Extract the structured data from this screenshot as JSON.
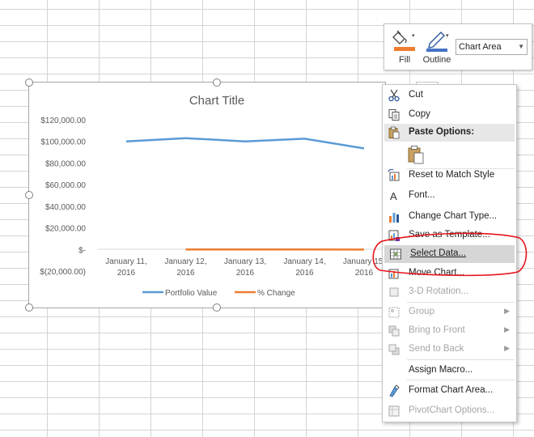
{
  "format_toolbar": {
    "fill_label": "Fill",
    "outline_label": "Outline",
    "element_select": "Chart Area"
  },
  "chart": {
    "title": "Chart Title",
    "y_ticks": [
      "$120,000.00",
      "$100,000.00",
      "$80,000.00",
      "$60,000.00",
      "$40,000.00",
      "$20,000.00",
      "$-",
      "$(20,000.00)"
    ],
    "x_labels": [
      {
        "line1": "January 11,",
        "line2": "2016"
      },
      {
        "line1": "January 12,",
        "line2": "2016"
      },
      {
        "line1": "January 13,",
        "line2": "2016"
      },
      {
        "line1": "January 14,",
        "line2": "2016"
      },
      {
        "line1": "January 15,",
        "line2": "2016"
      }
    ],
    "legend": [
      {
        "name": "Portfolio Value",
        "color": "#5b9bd5"
      },
      {
        "name": "% Change",
        "color": "#ed7d31"
      }
    ]
  },
  "chart_data": {
    "type": "line",
    "title": "Chart Title",
    "categories": [
      "January 11, 2016",
      "January 12, 2016",
      "January 13, 2016",
      "January 14, 2016",
      "January 15, 2016"
    ],
    "ylim": [
      -20000,
      120000
    ],
    "grid": false,
    "legend": "bottom",
    "series": [
      {
        "name": "Portfolio Value",
        "color": "#5b9bd5",
        "values": [
          100000,
          103000,
          100000,
          102500,
          93500
        ]
      },
      {
        "name": "% Change",
        "color": "#ed7d31",
        "values": [
          null,
          0,
          0,
          0,
          -100
        ]
      }
    ]
  },
  "context_menu": {
    "items": [
      {
        "label": "Cut",
        "icon": "scissors-icon"
      },
      {
        "label": "Copy",
        "icon": "copy-icon"
      },
      {
        "label": "Paste Options:",
        "icon": "paste-icon"
      },
      {
        "label": "Reset to Match Style",
        "icon": "reset-style-icon"
      },
      {
        "label": "Font...",
        "icon": "font-icon"
      },
      {
        "label": "Change Chart Type...",
        "icon": "chart-type-icon"
      },
      {
        "label": "Save as Template...",
        "icon": "template-icon"
      },
      {
        "label": "Select Data...",
        "icon": "select-data-icon"
      },
      {
        "label": "Move Chart...",
        "icon": "move-chart-icon"
      },
      {
        "label": "3-D Rotation...",
        "icon": "rotation-icon"
      },
      {
        "label": "Group",
        "icon": "group-icon"
      },
      {
        "label": "Bring to Front",
        "icon": "bring-front-icon"
      },
      {
        "label": "Send to Back",
        "icon": "send-back-icon"
      },
      {
        "label": "Assign Macro...",
        "icon": ""
      },
      {
        "label": "Format Chart Area...",
        "icon": "format-area-icon"
      },
      {
        "label": "PivotChart Options...",
        "icon": "pivot-options-icon"
      }
    ],
    "highlighted": "Select Data...",
    "annotation_color": "#e8131b"
  }
}
